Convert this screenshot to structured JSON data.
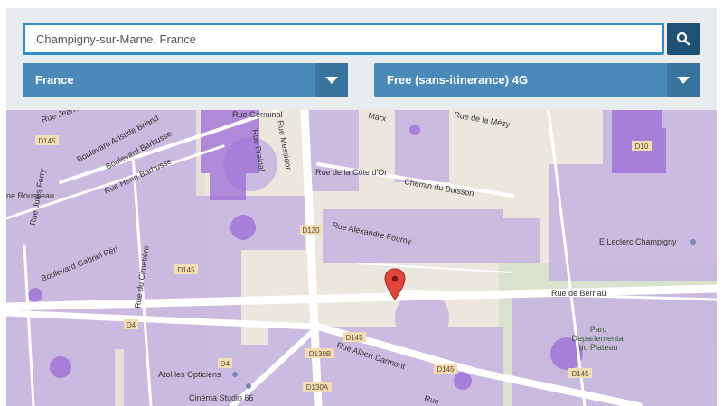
{
  "search": {
    "value": "Champigny-sur-Marne, France",
    "placeholder": ""
  },
  "filters": {
    "country_selected": "France",
    "network_selected": "Free (sans-itinerance) 4G"
  },
  "icons": {
    "search_button": "search-icon",
    "dropdown_caret": "caret-down-icon",
    "marker": "map-pin-icon"
  },
  "colors": {
    "accent": "#2f8fc4",
    "search_button": "#1f5176",
    "dropdown": "#4a8ab8",
    "coverage_light": "#c6b4e2",
    "coverage_dark": "#9c6bd6",
    "marker": "#e2453c"
  },
  "map": {
    "streets": [
      "Rue Jean Al",
      "Boulevard Aristide Briand",
      "Rue Germinal",
      "Rue Messidor",
      "Rue Prairial",
      "Marx",
      "Rue de la Mézy",
      "Boulevard Barbusse",
      "Rue Henri Barbusse",
      "Rue de la Côte d'Or",
      "Chemin du Buisson",
      "ne Rousseau",
      "Rue Alexandre Fourny",
      "Rue Jules Ferry",
      "Boulevard Gabriel Péri",
      "Rue du Cimetière",
      "Rue de Bernaü",
      "Rue Albert Darmont",
      "Rue"
    ],
    "road_labels": [
      "D145",
      "D10",
      "D130",
      "D145",
      "D4",
      "D145",
      "D130B",
      "D145",
      "D145",
      "D4",
      "D130A"
    ],
    "places": [
      "E.Leclerc Champigny",
      "Parc Departemental du Plateau",
      "Atol les Opticiens",
      "Cinéma Studio 66"
    ],
    "park_lines": [
      "Parc",
      "Departemental",
      "du Plateau"
    ]
  }
}
